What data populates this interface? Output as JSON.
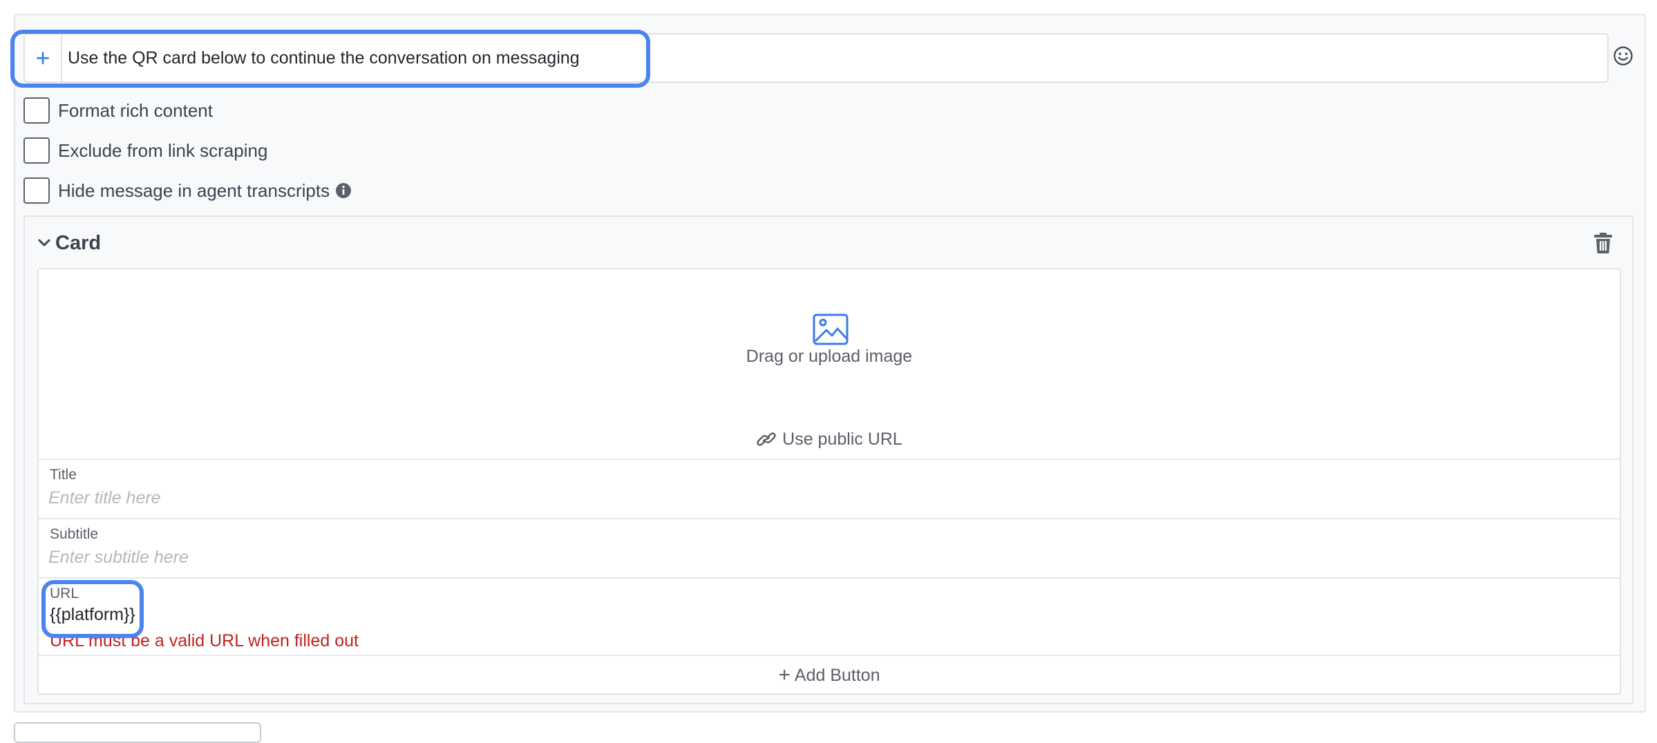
{
  "message": {
    "text": "Use the QR card below to continue the conversation on messaging",
    "add_icon": "plus-icon",
    "emoji_icon": "smile-icon"
  },
  "options": [
    {
      "label": "Format rich content",
      "checked": false
    },
    {
      "label": "Exclude from link scraping",
      "checked": false
    },
    {
      "label": "Hide message in agent transcripts",
      "checked": false,
      "icon": "info-icon"
    }
  ],
  "card": {
    "title": "Card",
    "collapse_icon": "chevron-down-icon",
    "delete_icon": "trash-icon",
    "upload": {
      "icon": "image-icon",
      "label": "Drag or upload image",
      "public_url_label": "Use public URL",
      "public_url_icon": "link-icon"
    },
    "fields": {
      "title": {
        "label": "Title",
        "placeholder": "Enter title here",
        "value": ""
      },
      "subtitle": {
        "label": "Subtitle",
        "placeholder": "Enter subtitle here",
        "value": ""
      },
      "url": {
        "label": "URL",
        "value": "{{platform}}",
        "error": "URL must be a valid URL when filled out"
      }
    },
    "add_button_label": "Add Button"
  },
  "colors": {
    "accent": "#4a84ee",
    "error": "#c0231f"
  }
}
